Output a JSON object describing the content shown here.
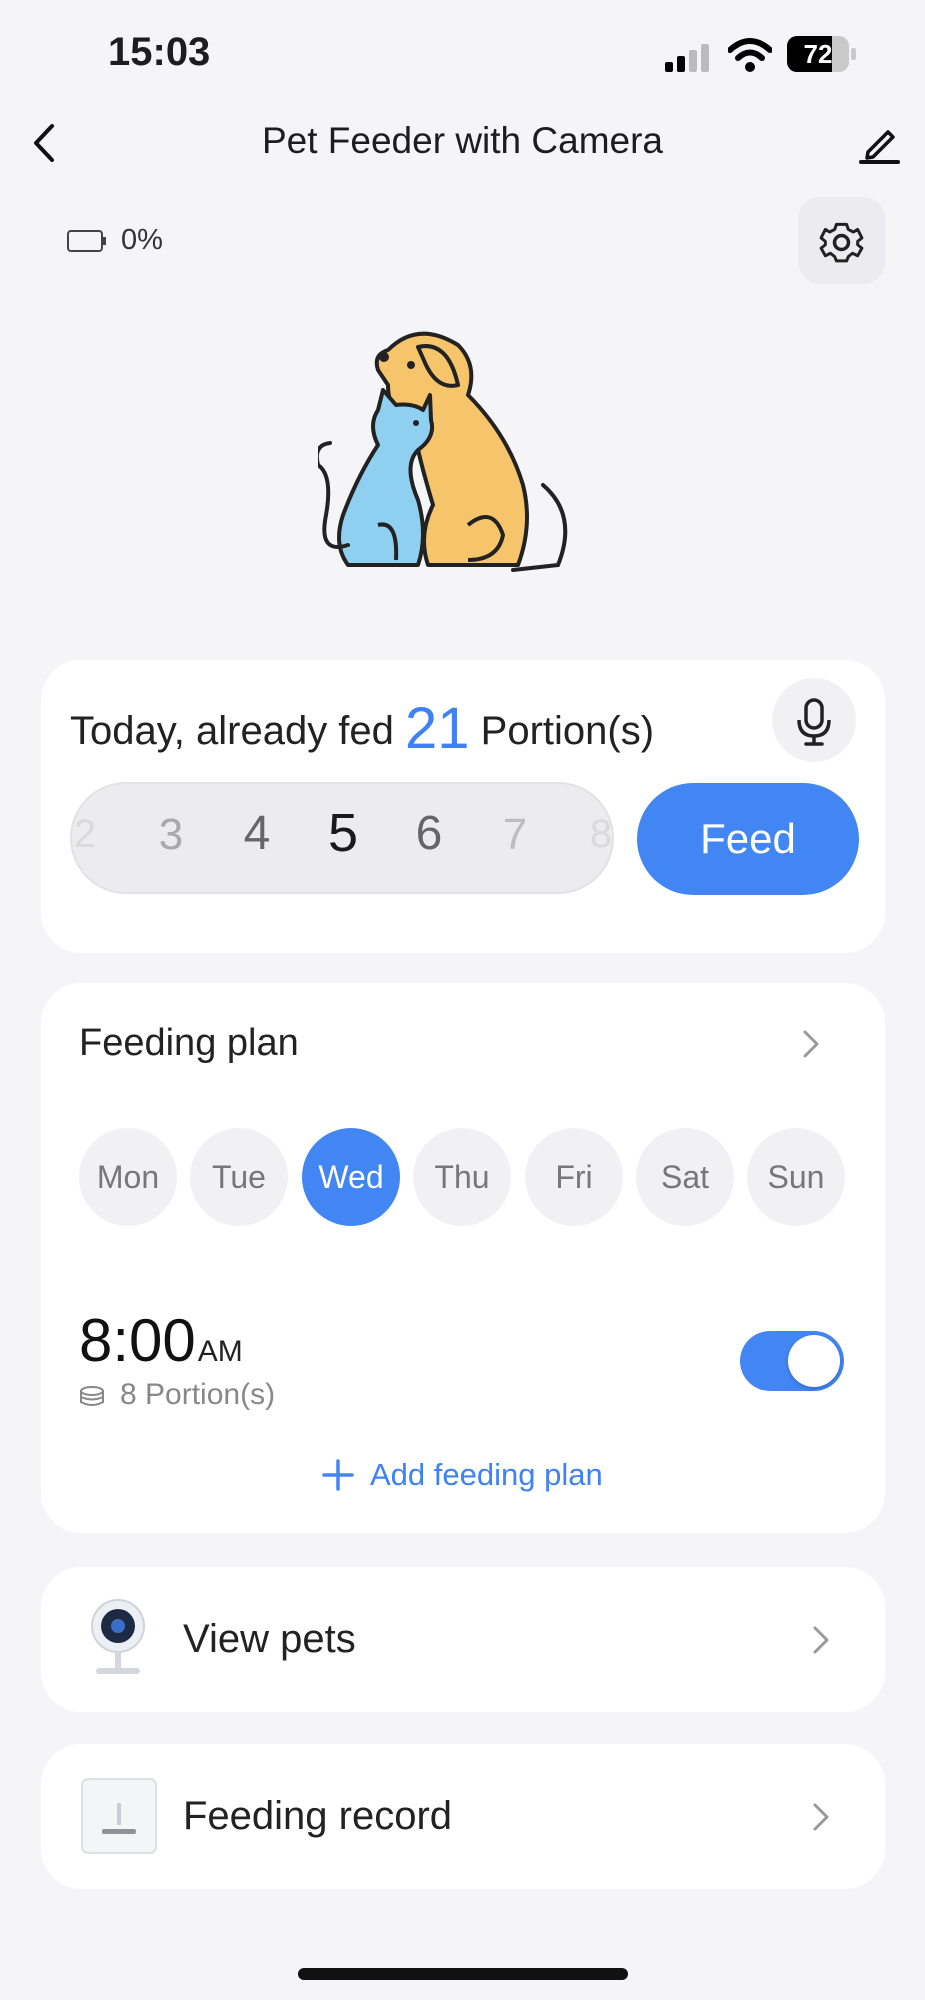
{
  "status_bar": {
    "time": "15:03",
    "battery": "72"
  },
  "nav": {
    "title": "Pet Feeder with Camera"
  },
  "device": {
    "battery_percent": "0%"
  },
  "feed_card": {
    "fed_prefix": "Today, already fed",
    "fed_count": "21",
    "fed_suffix": "Portion(s)",
    "portion_options": [
      "2",
      "3",
      "4",
      "5",
      "6",
      "7",
      "8"
    ],
    "selected_portion": "5",
    "feed_label": "Feed"
  },
  "feeding_plan": {
    "title": "Feeding plan",
    "days": [
      "Mon",
      "Tue",
      "Wed",
      "Thu",
      "Fri",
      "Sat",
      "Sun"
    ],
    "selected_day": "Wed",
    "schedule": {
      "time": "8:00",
      "period": "AM",
      "portions": "8 Portion(s)",
      "enabled": true
    },
    "add_label": "Add feeding plan"
  },
  "view_pets": {
    "label": "View pets"
  },
  "feeding_record": {
    "label": "Feeding record"
  },
  "colors": {
    "accent": "#4286f4",
    "background": "#f5f5f8"
  },
  "icons": [
    "back-arrow-icon",
    "edit-pencil-icon",
    "battery-icon",
    "gear-icon",
    "mic-icon",
    "chevron-right-icon",
    "portion-bowl-icon",
    "plus-icon",
    "camera-device-icon",
    "feeder-device-icon"
  ]
}
